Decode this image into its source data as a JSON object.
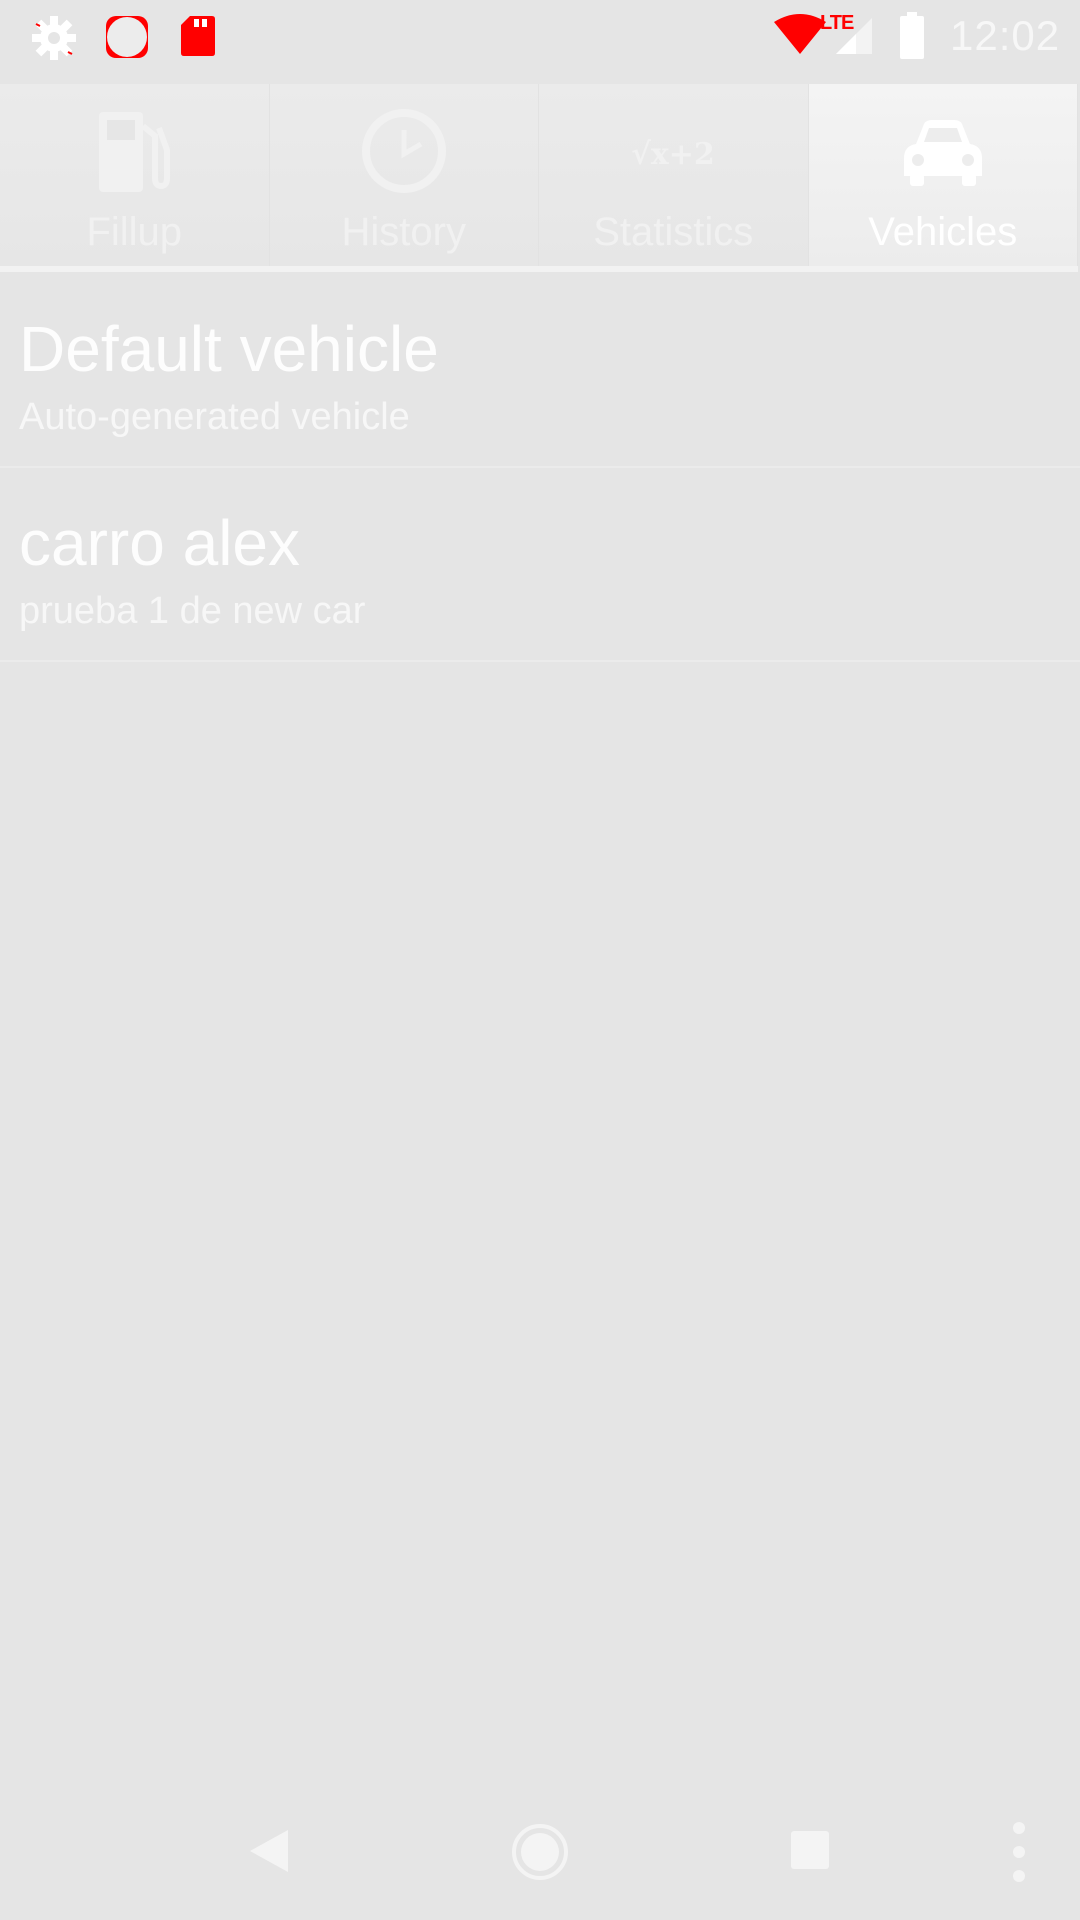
{
  "status_bar": {
    "time": "12:02",
    "network_label": "LTE",
    "icons": [
      "gear-icon",
      "circle-icon",
      "sd-card-icon",
      "wifi-icon",
      "cell-signal-icon",
      "battery-icon"
    ],
    "colors": {
      "alert": "#ff0000"
    }
  },
  "tabs": [
    {
      "label": "Fillup",
      "icon": "fuel-pump-icon",
      "active": false
    },
    {
      "label": "History",
      "icon": "clock-icon",
      "active": false
    },
    {
      "label": "Statistics",
      "icon": "sqrt-formula-icon",
      "active": false
    },
    {
      "label": "Vehicles",
      "icon": "car-icon",
      "active": true
    }
  ],
  "statistics_icon_text": "√x+2",
  "vehicles": [
    {
      "name": "Default vehicle",
      "description": "Auto-generated vehicle"
    },
    {
      "name": "carro alex",
      "description": "prueba 1 de new car"
    }
  ],
  "nav_bar": {
    "buttons": [
      "back-icon",
      "home-icon",
      "recent-apps-icon",
      "overflow-menu-icon"
    ]
  },
  "theme": {
    "background": "#e5e5e5",
    "text": "#ffffff"
  }
}
